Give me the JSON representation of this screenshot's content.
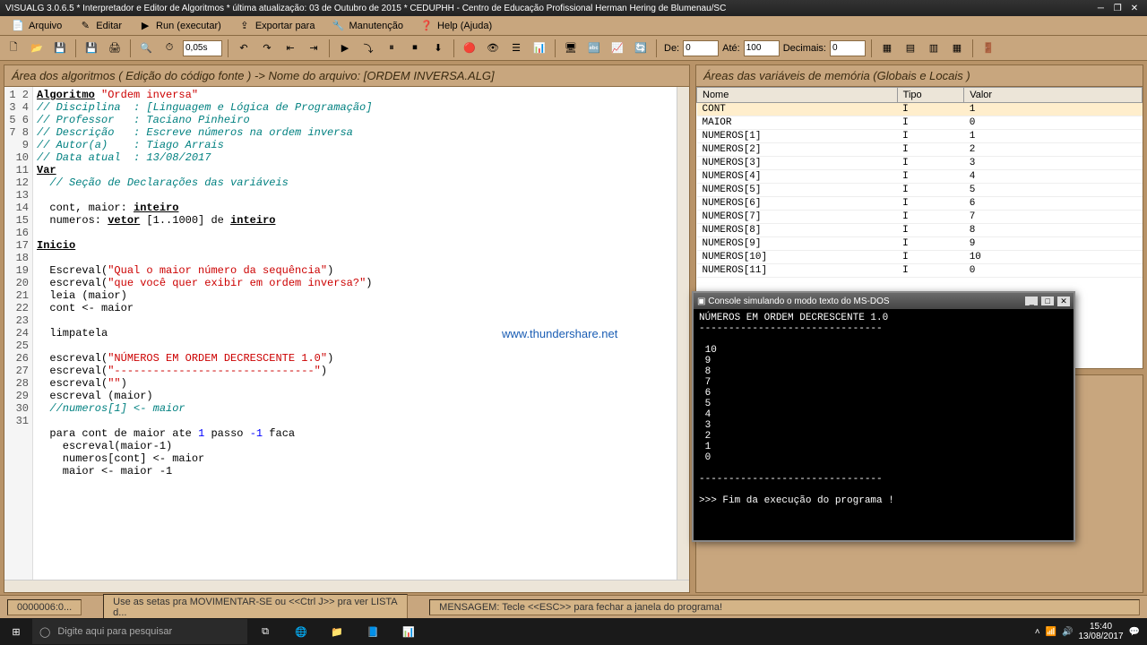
{
  "window": {
    "title": "VISUALG 3.0.6.5 * Interpretador e Editor de Algoritmos * última atualização: 03 de Outubro de 2015 * CEDUPHH - Centro de Educação Profissional Herman Hering de Blumenau/SC"
  },
  "menu": {
    "arquivo": "Arquivo",
    "editar": "Editar",
    "run": "Run (executar)",
    "exportar": "Exportar para",
    "manutencao": "Manutenção",
    "help": "Help (Ajuda)"
  },
  "toolbar": {
    "timer_value": "0,05s",
    "de_label": "De:",
    "de_value": "0",
    "ate_label": "Até:",
    "ate_value": "100",
    "decimais_label": "Decimais:",
    "decimais_value": "0"
  },
  "editor": {
    "title": "Área dos algoritmos ( Edição do código fonte ) -> Nome do arquivo: [ORDEM INVERSA.ALG]",
    "lines": [
      "1",
      "2",
      "3",
      "4",
      "5",
      "6",
      "7",
      "8",
      "9",
      "10",
      "11",
      "12",
      "13",
      "14",
      "15",
      "16",
      "17",
      "18",
      "19",
      "20",
      "21",
      "22",
      "23",
      "24",
      "25",
      "26",
      "27",
      "28",
      "29",
      "30",
      "31"
    ]
  },
  "code": {
    "l1_kw": "Algoritmo",
    "l1_str": "\"Ordem inversa\"",
    "l2": "// Disciplina  : [Linguagem e Lógica de Programação]",
    "l3": "// Professor   : Taciano Pinheiro",
    "l4": "// Descrição   : Escreve números na ordem inversa",
    "l5": "// Autor(a)    : Tiago Arrais",
    "l6": "// Data atual  : 13/08/2017",
    "l7": "Var",
    "l8": "  // Seção de Declarações das variáveis",
    "l10a": "  cont, maior: ",
    "l10b": "inteiro",
    "l11a": "  numeros: ",
    "l11b": "vetor",
    "l11c": " [1..1000] de ",
    "l11d": "inteiro",
    "l13": "Inicio",
    "l15a": "  Escreval(",
    "l15b": "\"Qual o maior número da sequência\"",
    "l15c": ")",
    "l16a": "  escreval(",
    "l16b": "\"que você quer exibir em ordem inversa?\"",
    "l16c": ")",
    "l17": "  leia (maior)",
    "l18": "  cont <- maior",
    "l20": "  limpatela",
    "l22a": "  escreval(",
    "l22b": "\"NÚMEROS EM ORDEM DECRESCENTE 1.0\"",
    "l22c": ")",
    "l23a": "  escreval(",
    "l23b": "\"-------------------------------\"",
    "l23c": ")",
    "l24a": "  escreval(",
    "l24b": "\"\"",
    "l24c": ")",
    "l25": "  escreval (maior)",
    "l26": "  //numeros[1] <- maior",
    "l28a": "  para ",
    "l28b": "cont",
    "l28c": " de ",
    "l28d": "maior",
    "l28e": " ate ",
    "l28f": "1",
    "l28g": " passo ",
    "l28h": "-1",
    "l28i": " faca",
    "l29": "    escreval(maior-1)",
    "l30": "    numeros[cont] <- maior",
    "l31": "    maior <- maior -1"
  },
  "vars": {
    "title": "Áreas das variáveis de memória (Globais e Locais )",
    "h_nome": "Nome",
    "h_tipo": "Tipo",
    "h_valor": "Valor",
    "rows": [
      {
        "n": "CONT",
        "t": "I",
        "v": "1",
        "sel": true
      },
      {
        "n": "MAIOR",
        "t": "I",
        "v": "0"
      },
      {
        "n": "NUMEROS[1]",
        "t": "I",
        "v": "1"
      },
      {
        "n": "NUMEROS[2]",
        "t": "I",
        "v": "2"
      },
      {
        "n": "NUMEROS[3]",
        "t": "I",
        "v": "3"
      },
      {
        "n": "NUMEROS[4]",
        "t": "I",
        "v": "4"
      },
      {
        "n": "NUMEROS[5]",
        "t": "I",
        "v": "5"
      },
      {
        "n": "NUMEROS[6]",
        "t": "I",
        "v": "6"
      },
      {
        "n": "NUMEROS[7]",
        "t": "I",
        "v": "7"
      },
      {
        "n": "NUMEROS[8]",
        "t": "I",
        "v": "8"
      },
      {
        "n": "NUMEROS[9]",
        "t": "I",
        "v": "9"
      },
      {
        "n": "NUMEROS[10]",
        "t": "I",
        "v": "10"
      },
      {
        "n": "NUMEROS[11]",
        "t": "I",
        "v": "0"
      }
    ]
  },
  "console": {
    "title": "Console simulando o modo texto do MS-DOS",
    "output": "NÚMEROS EM ORDEM DECRESCENTE 1.0\n-------------------------------\n\n 10\n 9\n 8\n 7\n 6\n 5\n 4\n 3\n 2\n 1\n 0\n\n-------------------------------\n\n>>> Fim da execução do programa !"
  },
  "status": {
    "pos": "0000006:0...",
    "hint": "Use as setas pra MOVIMENTAR-SE ou <<Ctrl J>> pra ver LISTA d...",
    "msg": "MENSAGEM: Tecle <<ESC>> para fechar a janela do programa!"
  },
  "watermark": "www.thundershare.net",
  "taskbar": {
    "search_placeholder": "Digite aqui para pesquisar",
    "time": "15:40",
    "date": "13/08/2017"
  }
}
